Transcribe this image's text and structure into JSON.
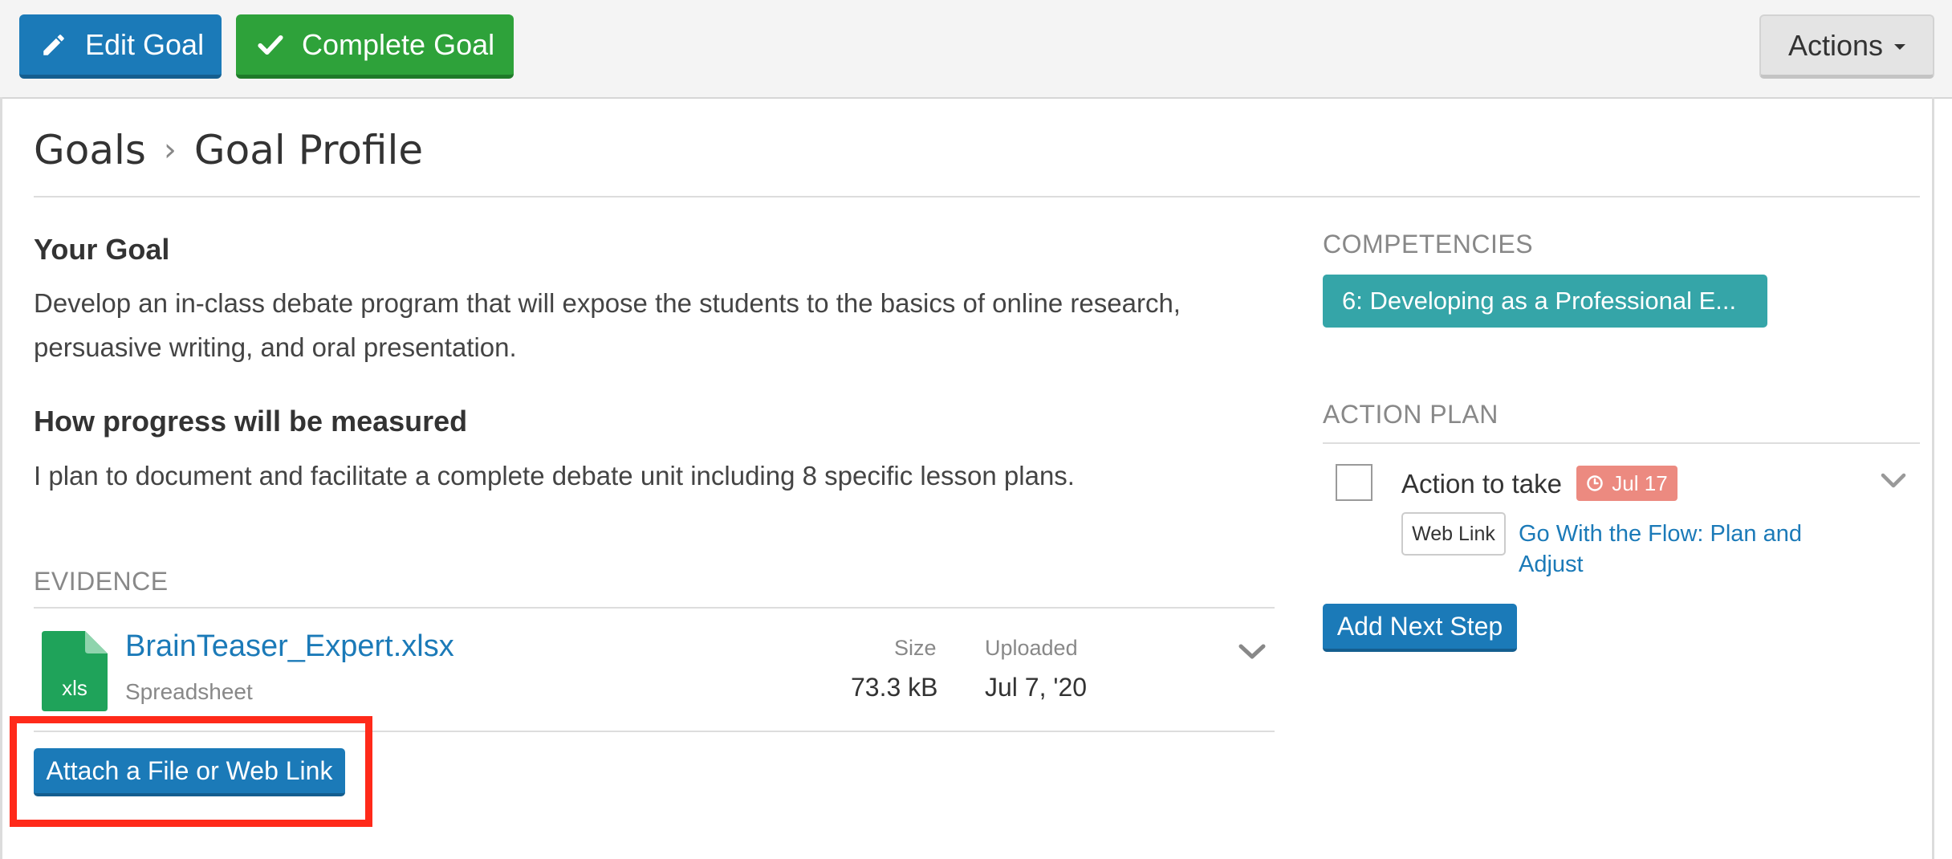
{
  "toolbar": {
    "edit_label": "Edit Goal",
    "complete_label": "Complete Goal",
    "actions_label": "Actions"
  },
  "breadcrumb": {
    "parent": "Goals",
    "current": "Goal Profile"
  },
  "goal": {
    "heading": "Your Goal",
    "text_line1": "Develop an in-class debate program that will expose the students to the basics of online research,",
    "text_line2": "persuasive writing, and oral presentation."
  },
  "progress": {
    "heading": "How progress will be measured",
    "text": "I plan to document and facilitate a complete debate unit including 8 specific lesson plans."
  },
  "evidence": {
    "heading": "EVIDENCE",
    "file": {
      "icon_label": "xls",
      "name": "BrainTeaser_Expert.xlsx",
      "type": "Spreadsheet",
      "size_label": "Size",
      "size": "73.3 kB",
      "uploaded_label": "Uploaded",
      "uploaded": "Jul 7, '20"
    },
    "attach_label": "Attach a File or Web Link"
  },
  "competencies": {
    "heading": "COMPETENCIES",
    "item": "6:  Developing as a Professional E..."
  },
  "action_plan": {
    "heading": "ACTION PLAN",
    "item": {
      "title": "Action to take",
      "due": "Jul 17",
      "tag": "Web Link",
      "link_line1": "Go With the Flow: Plan and",
      "link_line2": "Adjust"
    },
    "add_label": "Add Next Step"
  },
  "colors": {
    "primary": "#1b7ab8",
    "success": "#2ea23a",
    "competency": "#35a5a8",
    "due_badge": "#ec8a80",
    "highlight": "#ff2a1a",
    "spreadsheet": "#1fa35a"
  },
  "icons": {
    "edit": "pencil-icon",
    "complete": "checkmark-icon",
    "actions": "caret-down-icon",
    "file": "spreadsheet-file-icon",
    "expand": "chevron-down-icon",
    "due": "clock-icon"
  }
}
